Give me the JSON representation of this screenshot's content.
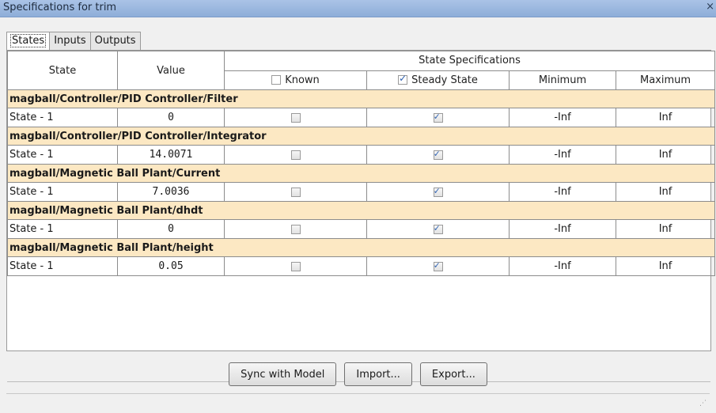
{
  "window": {
    "title": "Specifications for trim",
    "close_glyph": "×"
  },
  "tabs": [
    {
      "label": "States",
      "active": true
    },
    {
      "label": "Inputs",
      "active": false
    },
    {
      "label": "Outputs",
      "active": false
    }
  ],
  "table": {
    "headers": {
      "state": "State",
      "value": "Value",
      "group": "State Specifications",
      "known": "Known",
      "steady_state": "Steady State",
      "minimum": "Minimum",
      "maximum": "Maximum"
    },
    "header_known_checked": false,
    "header_steady_checked": true,
    "blocks": [
      {
        "block": "magball/Controller/PID Controller/Filter",
        "state": "State - 1",
        "value": "0",
        "known": false,
        "steady": true,
        "min": "-Inf",
        "max": "Inf"
      },
      {
        "block": "magball/Controller/PID Controller/Integrator",
        "state": "State - 1",
        "value": "14.0071",
        "known": false,
        "steady": true,
        "min": "-Inf",
        "max": "Inf"
      },
      {
        "block": "magball/Magnetic Ball Plant/Current",
        "state": "State - 1",
        "value": "7.0036",
        "known": false,
        "steady": true,
        "min": "-Inf",
        "max": "Inf"
      },
      {
        "block": "magball/Magnetic Ball Plant/dhdt",
        "state": "State - 1",
        "value": "0",
        "known": false,
        "steady": true,
        "min": "-Inf",
        "max": "Inf"
      },
      {
        "block": "magball/Magnetic Ball Plant/height",
        "state": "State - 1",
        "value": "0.05",
        "known": false,
        "steady": true,
        "min": "-Inf",
        "max": "Inf"
      }
    ]
  },
  "buttons": {
    "sync": "Sync with Model",
    "import": "Import...",
    "export": "Export..."
  },
  "resize_grip_glyph": "⋰"
}
